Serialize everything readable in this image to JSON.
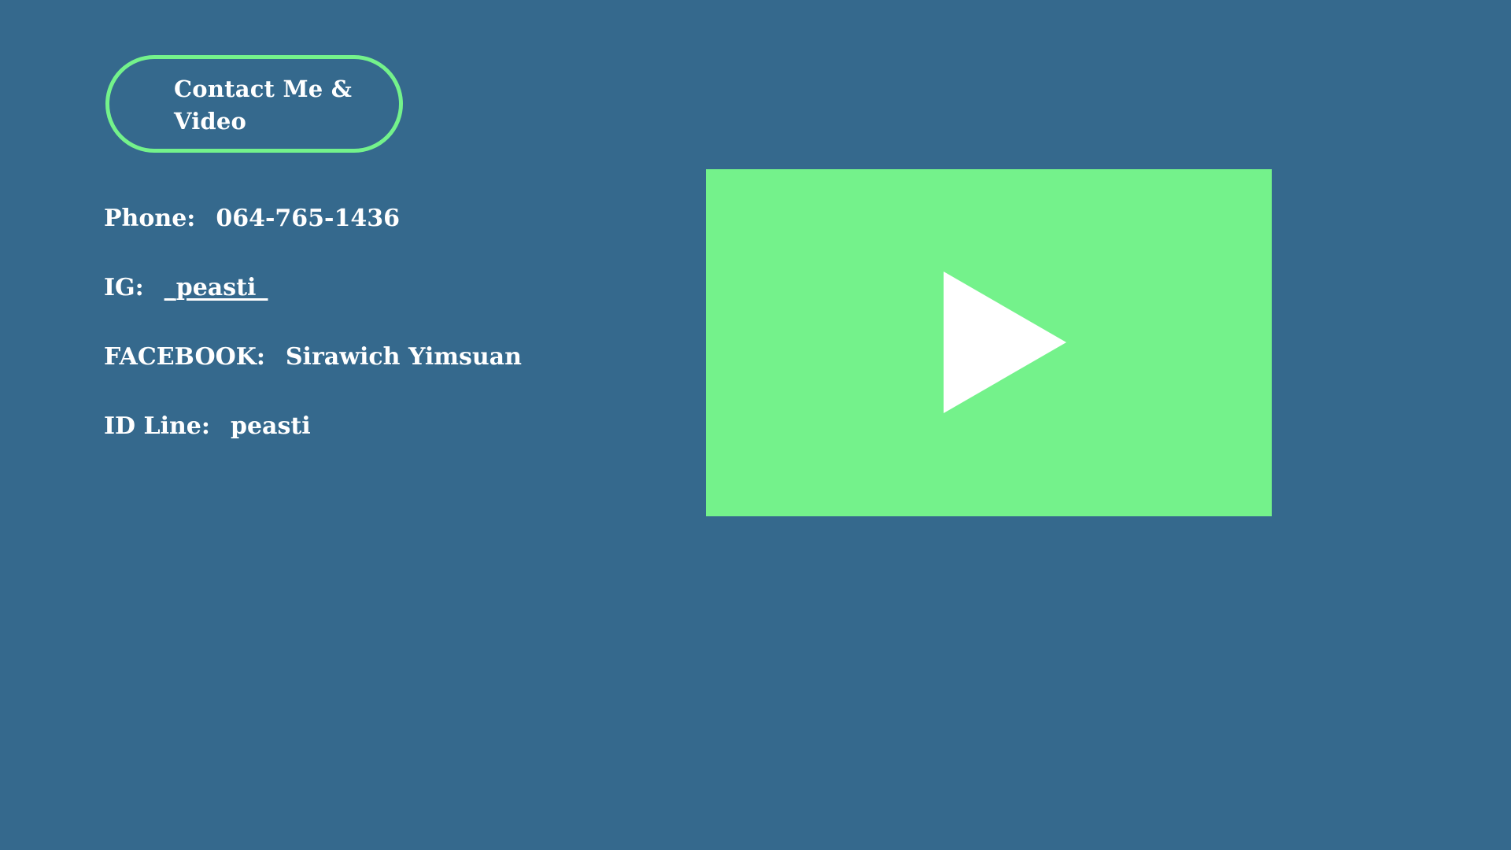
{
  "title": "Contact Me & Video",
  "contacts": {
    "phone": {
      "label": "Phone:",
      "value": "064-765-1436"
    },
    "ig": {
      "label": "IG:",
      "value": "_peasti_"
    },
    "facebook": {
      "label": "FACEBOOK:",
      "value": "Sirawich Yimsuan"
    },
    "line": {
      "label": "ID Line:",
      "value": "peasti"
    }
  },
  "video": {
    "icon": "play-icon"
  },
  "colors": {
    "background": "#35698d",
    "accent": "#74f28b",
    "text": "#ffffff"
  }
}
